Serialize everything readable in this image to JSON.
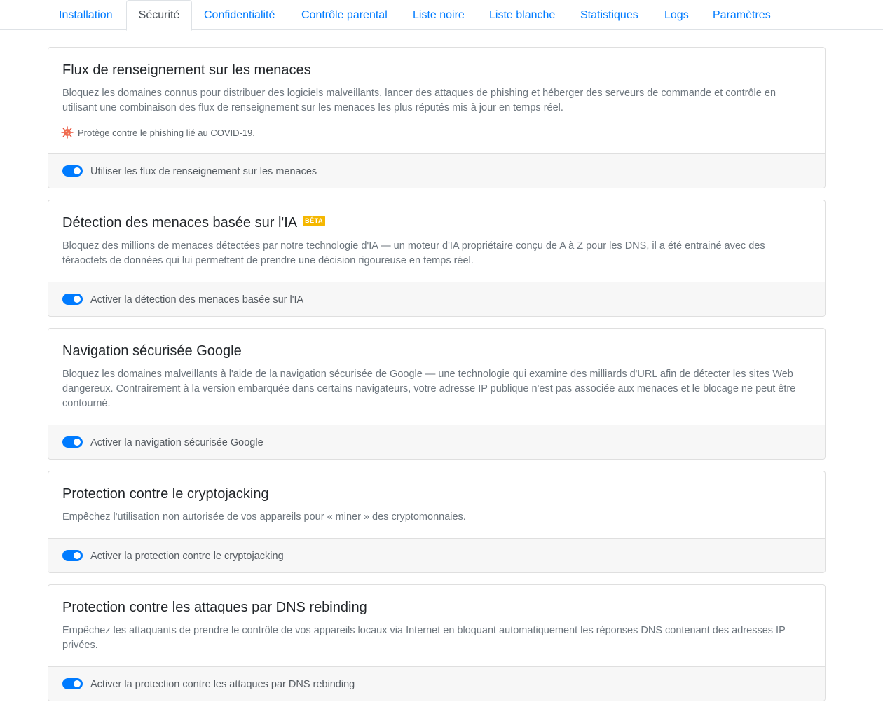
{
  "tabs": [
    {
      "label": "Installation"
    },
    {
      "label": "Sécurité"
    },
    {
      "label": "Confidentialité"
    },
    {
      "label": "Contrôle parental"
    },
    {
      "label": "Liste noire"
    },
    {
      "label": "Liste blanche"
    },
    {
      "label": "Statistiques"
    },
    {
      "label": "Logs"
    },
    {
      "label": "Paramètres"
    }
  ],
  "active_tab": "Sécurité",
  "accent_color": "#007bff",
  "cards": [
    {
      "title": "Flux de renseignement sur les menaces",
      "description": "Bloquez les domaines connus pour distribuer des logiciels malveillants, lancer des attaques de phishing et héberger des serveurs de commande et contrôle en utilisant une combinaison des flux de renseignement sur les menaces les plus réputés mis à jour en temps réel.",
      "note": "Protège contre le phishing lié au COVID-19.",
      "note_icon": "virus-icon",
      "toggle_label": "Utiliser les flux de renseignement sur les menaces",
      "enabled": true
    },
    {
      "title": "Détection des menaces basée sur l'IA",
      "badge": "BÊTA",
      "description": "Bloquez des millions de menaces détectées par notre technologie d'IA — un moteur d'IA propriétaire conçu de A à Z pour les DNS, il a été entrainé avec des téraoctets de données qui lui permettent de prendre une décision rigoureuse en temps réel.",
      "toggle_label": "Activer la détection des menaces basée sur l'IA",
      "enabled": true
    },
    {
      "title": "Navigation sécurisée Google",
      "description": "Bloquez les domaines malveillants à l'aide de la navigation sécurisée de Google — une technologie qui examine des milliards d'URL afin de détecter les sites Web dangereux. Contrairement à la version embarquée dans certains navigateurs, votre adresse IP publique n'est pas associée aux menaces et le blocage ne peut être contourné.",
      "toggle_label": "Activer la navigation sécurisée Google",
      "enabled": true
    },
    {
      "title": "Protection contre le cryptojacking",
      "description": "Empêchez l'utilisation non autorisée de vos appareils pour « miner » des cryptomonnaies.",
      "toggle_label": "Activer la protection contre le cryptojacking",
      "enabled": true
    },
    {
      "title": "Protection contre les attaques par DNS rebinding",
      "description": "Empêchez les attaquants de prendre le contrôle de vos appareils locaux via Internet en bloquant automatiquement les réponses DNS contenant des adresses IP privées.",
      "toggle_label": "Activer la protection contre les attaques par DNS rebinding",
      "enabled": true
    }
  ]
}
